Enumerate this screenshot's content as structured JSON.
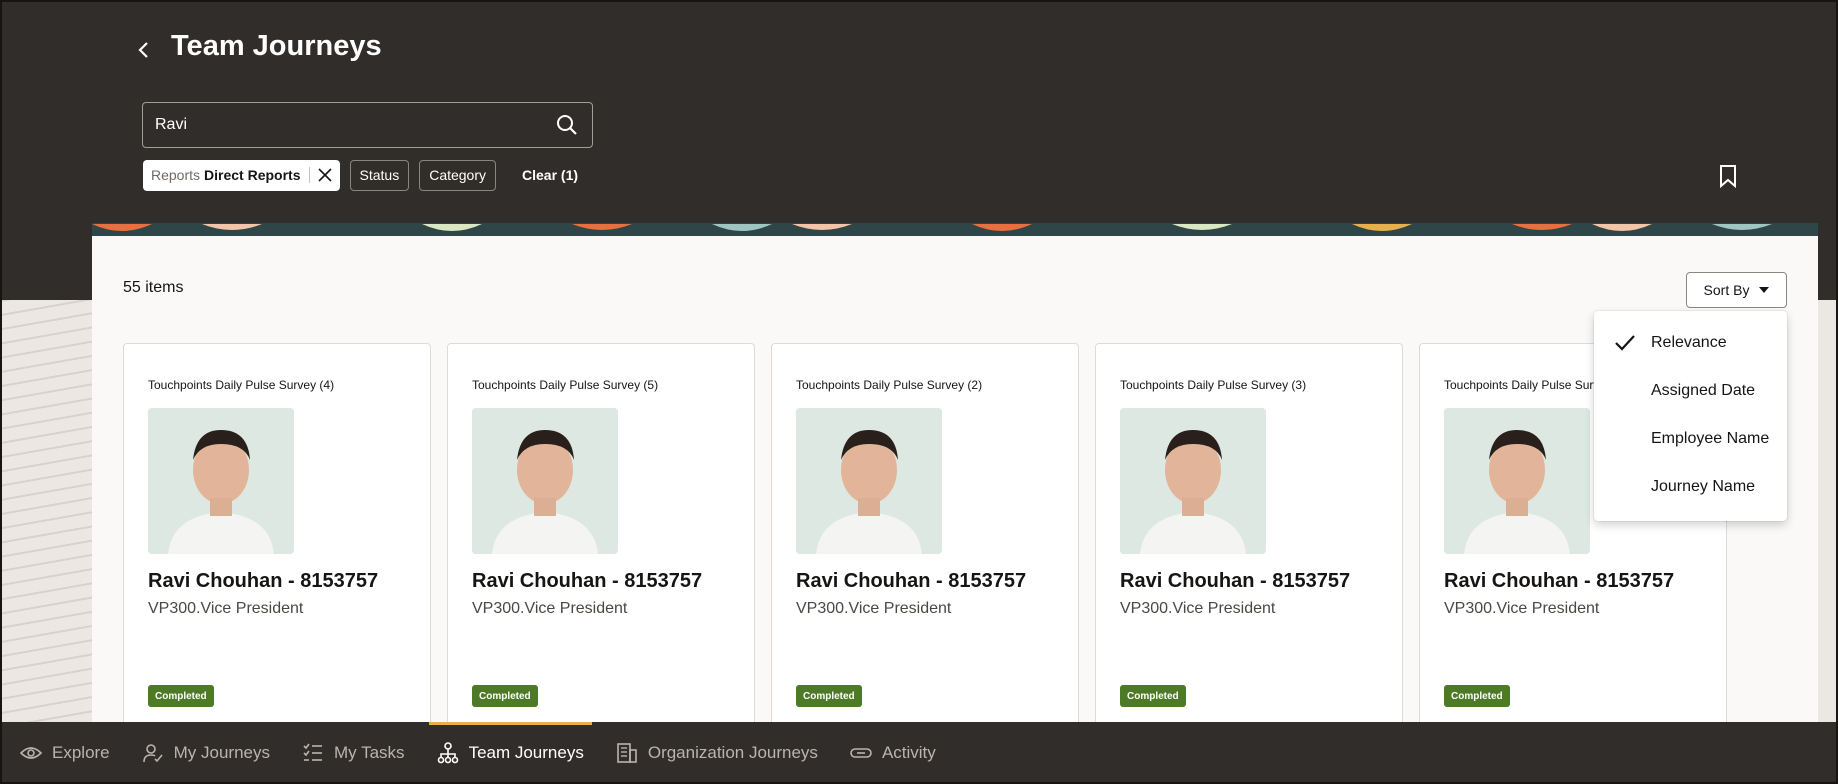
{
  "header": {
    "title": "Team Journeys",
    "search_value": "Ravi",
    "filters": {
      "active_chip": {
        "label": "Reports",
        "value": "Direct Reports"
      },
      "chips": [
        "Status",
        "Category"
      ],
      "clear_label": "Clear (1)"
    }
  },
  "results": {
    "count_label": "55 items",
    "sort_label": "Sort By",
    "sort_options": [
      {
        "label": "Relevance",
        "selected": true
      },
      {
        "label": "Assigned Date",
        "selected": false
      },
      {
        "label": "Employee Name",
        "selected": false
      },
      {
        "label": "Journey Name",
        "selected": false
      }
    ],
    "cards": [
      {
        "survey": "Touchpoints Daily Pulse Survey (4)",
        "name": "Ravi Chouhan - 8153757",
        "role": "VP300.Vice President",
        "status": "Completed"
      },
      {
        "survey": "Touchpoints Daily Pulse Survey (5)",
        "name": "Ravi Chouhan - 8153757",
        "role": "VP300.Vice President",
        "status": "Completed"
      },
      {
        "survey": "Touchpoints Daily Pulse Survey (2)",
        "name": "Ravi Chouhan - 8153757",
        "role": "VP300.Vice President",
        "status": "Completed"
      },
      {
        "survey": "Touchpoints Daily Pulse Survey (3)",
        "name": "Ravi Chouhan - 8153757",
        "role": "VP300.Vice President",
        "status": "Completed"
      },
      {
        "survey": "Touchpoints Daily Pulse Survey (1)",
        "name": "Ravi Chouhan - 8153757",
        "role": "VP300.Vice President",
        "status": "Completed"
      }
    ]
  },
  "bottom_nav": [
    {
      "label": "Explore",
      "icon": "eye-icon",
      "active": false
    },
    {
      "label": "My Journeys",
      "icon": "person-check-icon",
      "active": false
    },
    {
      "label": "My Tasks",
      "icon": "checklist-icon",
      "active": false
    },
    {
      "label": "Team Journeys",
      "icon": "org-chart-icon",
      "active": true
    },
    {
      "label": "Organization Journeys",
      "icon": "building-icon",
      "active": false
    },
    {
      "label": "Activity",
      "icon": "link-icon",
      "active": false
    }
  ],
  "colors": {
    "header_bg": "#312d2a",
    "badge_completed": "#4d7a26",
    "nav_active_indicator": "#e8b04c"
  }
}
